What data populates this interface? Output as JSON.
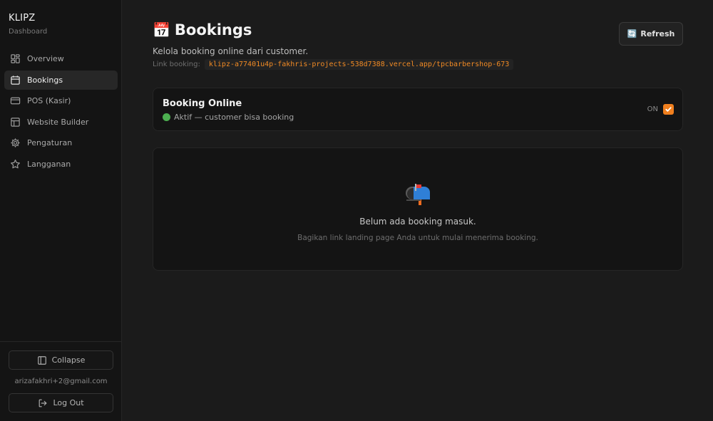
{
  "brand": {
    "name": "KLIPZ",
    "subtitle": "Dashboard"
  },
  "sidebar": {
    "items": [
      {
        "label": "Overview",
        "icon": "grid-icon",
        "active": false
      },
      {
        "label": "Bookings",
        "icon": "calendar-icon",
        "active": true
      },
      {
        "label": "POS (Kasir)",
        "icon": "credit-card-icon",
        "active": false
      },
      {
        "label": "Website Builder",
        "icon": "layout-icon",
        "active": false
      },
      {
        "label": "Pengaturan",
        "icon": "gear-icon",
        "active": false
      },
      {
        "label": "Langganan",
        "icon": "star-icon",
        "active": false
      }
    ],
    "collapse_label": "Collapse",
    "user_email": "arizafakhri+2@gmail.com",
    "logout_label": "Log Out"
  },
  "header": {
    "title": "Bookings",
    "title_emoji": "📅",
    "subtitle": "Kelola booking online dari customer.",
    "link_label": "Link booking:",
    "link_url": "klipz-a77401u4p-fakhris-projects-538d7388.vercel.app/tpcbarbershop-673",
    "refresh_emoji": "🔄",
    "refresh_label": "Refresh"
  },
  "booking_toggle": {
    "title": "Booking Online",
    "status_text": "Aktif — customer bisa booking",
    "toggle_label": "ON",
    "checked": true
  },
  "empty_state": {
    "icon": "mailbox-icon",
    "title": "Belum ada booking masuk.",
    "description": "Bagikan link landing page Anda untuk mulai menerima booking."
  },
  "colors": {
    "accent": "#f07f1e",
    "status_active": "#4caf50",
    "link": "#f08a24"
  }
}
